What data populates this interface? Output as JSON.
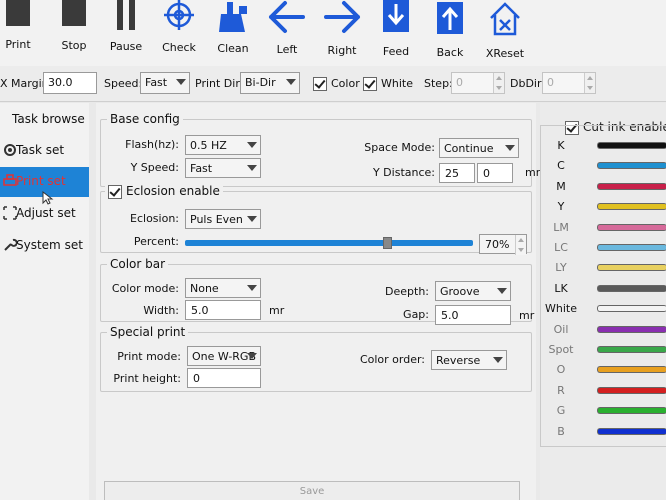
{
  "toolbar": {
    "buttons": [
      {
        "label": "Print",
        "icon": "printer-icon"
      },
      {
        "label": "Stop",
        "icon": "stop-icon"
      },
      {
        "label": "Pause",
        "icon": "pause-icon"
      },
      {
        "label": "Check",
        "icon": "crosshair-icon"
      },
      {
        "label": "Clean",
        "icon": "clean-icon"
      },
      {
        "label": "Left",
        "icon": "arrow-left-icon"
      },
      {
        "label": "Right",
        "icon": "arrow-right-icon"
      },
      {
        "label": "Feed",
        "icon": "feed-icon"
      },
      {
        "label": "Back",
        "icon": "back-icon"
      },
      {
        "label": "XReset",
        "icon": "home-x-icon"
      }
    ]
  },
  "strip": {
    "margin_label": "X Margin:",
    "margin_value": "30.0",
    "speed_label": "Speed:",
    "speed_value": "Fast",
    "printdir_label": "Print Dir:",
    "printdir_value": "Bi-Dir",
    "color_label": "Color",
    "white_label": "White",
    "step_label": "Step:",
    "step_value": "0",
    "dbdir_label": "DbDir:",
    "dbdir_value": "0"
  },
  "sidebar": {
    "items": [
      {
        "label": "Task browse"
      },
      {
        "label": "Task set"
      },
      {
        "label": "Print set"
      },
      {
        "label": "Adjust set"
      },
      {
        "label": "System set"
      }
    ]
  },
  "base_config": {
    "title": "Base config",
    "flash_label": "Flash(hz):",
    "flash_value": "0.5 HZ",
    "yspeed_label": "Y Speed:",
    "yspeed_value": "Fast",
    "space_mode_label": "Space Mode:",
    "space_mode_value": "Continue",
    "y_distance_label": "Y Distance:",
    "y_distance_value1": "25",
    "y_distance_value2": "0",
    "y_distance_unit": "mr"
  },
  "eclosion": {
    "title": "Eclosion enable",
    "eclosion_label": "Eclosion:",
    "eclosion_value": "Puls Even",
    "percent_label": "Percent:",
    "percent_value": "70%",
    "percent_level": 0.7
  },
  "color_bar": {
    "title": "Color bar",
    "mode_label": "Color mode:",
    "mode_value": "None",
    "width_label": "Width:",
    "width_value": "5.0",
    "width_unit": "mr",
    "deepth_label": "Deepth:",
    "deepth_value": "Groove",
    "gap_label": "Gap:",
    "gap_value": "5.0",
    "gap_unit": "mr"
  },
  "special_print": {
    "title": "Special print",
    "mode_label": "Print mode:",
    "mode_value": "One W-RGB",
    "height_label": "Print height:",
    "height_value": "0",
    "order_label": "Color order:",
    "order_value": "Reverse"
  },
  "save_label": "Save",
  "ink_panel": {
    "title": "Cut ink enable",
    "inks": [
      {
        "name": "K",
        "color": "#111111"
      },
      {
        "name": "C",
        "color": "#1e90d0"
      },
      {
        "name": "M",
        "color": "#c8204a"
      },
      {
        "name": "Y",
        "color": "#e0c020"
      },
      {
        "name": "LM",
        "color": "#d66a9a"
      },
      {
        "name": "LC",
        "color": "#6ab8de"
      },
      {
        "name": "LY",
        "color": "#e8d060"
      },
      {
        "name": "LK",
        "color": "#5a5a5a"
      },
      {
        "name": "White",
        "color": "#f4f4f4"
      },
      {
        "name": "Oil",
        "color": "#8a2fb0"
      },
      {
        "name": "Spot",
        "color": "#3aa84a"
      },
      {
        "name": "O",
        "color": "#e8a020"
      },
      {
        "name": "R",
        "color": "#d42020"
      },
      {
        "name": "G",
        "color": "#2ab030"
      },
      {
        "name": "B",
        "color": "#1030d0"
      }
    ]
  }
}
